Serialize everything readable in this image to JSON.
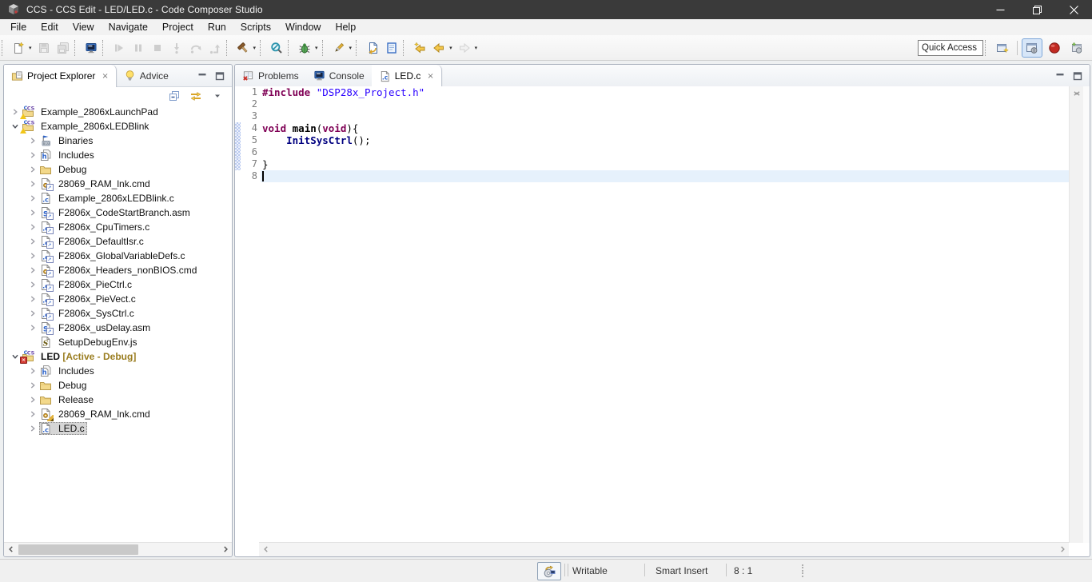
{
  "window": {
    "title": "CCS - CCS Edit - LED/LED.c - Code Composer Studio",
    "controls": [
      {
        "name": "minimize",
        "glyph": "minimize"
      },
      {
        "name": "restore",
        "glyph": "restore"
      },
      {
        "name": "close",
        "glyph": "close"
      }
    ]
  },
  "menu": {
    "items": [
      "File",
      "Edit",
      "View",
      "Navigate",
      "Project",
      "Run",
      "Scripts",
      "Window",
      "Help"
    ]
  },
  "toolbar": {
    "quick_access_placeholder": "Quick Access",
    "groups": [
      {
        "items": [
          {
            "name": "new",
            "icon": "new-file",
            "dropdown": true
          },
          {
            "name": "save",
            "icon": "save",
            "disabled": true
          },
          {
            "name": "save-all",
            "icon": "save-all",
            "disabled": true
          }
        ]
      },
      {
        "items": [
          {
            "name": "debug-target",
            "icon": "monitor"
          }
        ]
      },
      {
        "items": [
          {
            "name": "resume",
            "icon": "resume",
            "disabled": true
          },
          {
            "name": "suspend",
            "icon": "pause",
            "disabled": true
          },
          {
            "name": "terminate",
            "icon": "stop",
            "disabled": true
          },
          {
            "name": "step-into",
            "icon": "step-into",
            "disabled": true
          },
          {
            "name": "step-over",
            "icon": "step-over",
            "disabled": true
          },
          {
            "name": "step-return",
            "icon": "step-return",
            "disabled": true
          }
        ]
      },
      {
        "items": [
          {
            "name": "build",
            "icon": "hammer",
            "dropdown": true
          }
        ]
      },
      {
        "items": [
          {
            "name": "scan",
            "icon": "magnifier"
          }
        ]
      },
      {
        "items": [
          {
            "name": "debug",
            "icon": "bug",
            "dropdown": true
          }
        ]
      },
      {
        "items": [
          {
            "name": "flash",
            "icon": "flash",
            "dropdown": true
          }
        ]
      },
      {
        "items": [
          {
            "name": "last-edit-location",
            "icon": "edit-location"
          },
          {
            "name": "pin-editor",
            "icon": "pin-page"
          }
        ]
      },
      {
        "items": [
          {
            "name": "back-to-last-edit",
            "icon": "arrow-left-star"
          },
          {
            "name": "back",
            "icon": "arrow-left",
            "dropdown": true
          },
          {
            "name": "forward",
            "icon": "arrow-right",
            "disabled": true,
            "dropdown": true
          }
        ]
      }
    ],
    "perspectives": [
      {
        "name": "open-perspective",
        "icon": "persp-new",
        "active": false
      },
      {
        "name": "ccs-edit-perspective",
        "icon": "persp-edit",
        "active": true
      },
      {
        "name": "simple-perspective",
        "icon": "red-sphere",
        "active": false
      },
      {
        "name": "ccs-debug-perspective",
        "icon": "persp-debug",
        "active": false
      }
    ]
  },
  "sidebar": {
    "tabs": [
      {
        "label": "Project Explorer",
        "icon": "pe-folder",
        "active": true,
        "closable": true
      },
      {
        "label": "Advice",
        "icon": "bulb",
        "active": false,
        "closable": false
      }
    ],
    "toolbar": [
      {
        "name": "collapse-all",
        "icon": "collapse-all"
      },
      {
        "name": "link-with-editor",
        "icon": "link-editor"
      },
      {
        "name": "view-menu",
        "icon": "caret-down"
      }
    ],
    "tree": [
      {
        "label": "Example_2806xLaunchPad",
        "icon": "project-warning",
        "depth": 0,
        "arrow": "collapsed"
      },
      {
        "label": "Example_2806xLEDBlink",
        "icon": "project-warning",
        "depth": 0,
        "arrow": "expanded"
      },
      {
        "label": "Binaries",
        "icon": "binaries",
        "depth": 1,
        "arrow": "collapsed"
      },
      {
        "label": "Includes",
        "icon": "includes",
        "depth": 1,
        "arrow": "collapsed"
      },
      {
        "label": "Debug",
        "icon": "folder",
        "depth": 1,
        "arrow": "collapsed"
      },
      {
        "label": "28069_RAM_lnk.cmd",
        "icon": "file-cmd-linked",
        "depth": 1,
        "arrow": "collapsed"
      },
      {
        "label": "Example_2806xLEDBlink.c",
        "icon": "file-c",
        "depth": 1,
        "arrow": "collapsed"
      },
      {
        "label": "F2806x_CodeStartBranch.asm",
        "icon": "file-asm-linked",
        "depth": 1,
        "arrow": "collapsed"
      },
      {
        "label": "F2806x_CpuTimers.c",
        "icon": "file-c-linked",
        "depth": 1,
        "arrow": "collapsed"
      },
      {
        "label": "F2806x_DefaultIsr.c",
        "icon": "file-c-linked",
        "depth": 1,
        "arrow": "collapsed"
      },
      {
        "label": "F2806x_GlobalVariableDefs.c",
        "icon": "file-c-linked",
        "depth": 1,
        "arrow": "collapsed"
      },
      {
        "label": "F2806x_Headers_nonBIOS.cmd",
        "icon": "file-cmd-linked",
        "depth": 1,
        "arrow": "collapsed"
      },
      {
        "label": "F2806x_PieCtrl.c",
        "icon": "file-c-linked",
        "depth": 1,
        "arrow": "collapsed"
      },
      {
        "label": "F2806x_PieVect.c",
        "icon": "file-c-linked",
        "depth": 1,
        "arrow": "collapsed"
      },
      {
        "label": "F2806x_SysCtrl.c",
        "icon": "file-c-linked",
        "depth": 1,
        "arrow": "collapsed"
      },
      {
        "label": "F2806x_usDelay.asm",
        "icon": "file-asm-linked",
        "depth": 1,
        "arrow": "collapsed"
      },
      {
        "label": "SetupDebugEnv.js",
        "icon": "file-js",
        "depth": 1,
        "arrow": "none"
      },
      {
        "label": "LED",
        "suffix": " [Active - Debug]",
        "icon": "project-error",
        "depth": 0,
        "arrow": "expanded",
        "bold": true
      },
      {
        "label": "Includes",
        "icon": "includes",
        "depth": 1,
        "arrow": "collapsed"
      },
      {
        "label": "Debug",
        "icon": "folder",
        "depth": 1,
        "arrow": "collapsed"
      },
      {
        "label": "Release",
        "icon": "folder",
        "depth": 1,
        "arrow": "collapsed"
      },
      {
        "label": "28069_RAM_lnk.cmd",
        "icon": "file-cmd-edit",
        "depth": 1,
        "arrow": "collapsed"
      },
      {
        "label": "LED.c",
        "icon": "file-c",
        "depth": 1,
        "arrow": "collapsed",
        "selected": true
      }
    ]
  },
  "editor": {
    "tabs": [
      {
        "label": "Problems",
        "icon": "problems",
        "active": false,
        "closable": false
      },
      {
        "label": "Console",
        "icon": "monitor",
        "active": false,
        "closable": false
      },
      {
        "label": "LED.c",
        "icon": "file-c",
        "active": true,
        "closable": true
      }
    ],
    "caret_line": 8,
    "lines": [
      {
        "n": 1,
        "segs": [
          {
            "t": "#include ",
            "c": "pp"
          },
          {
            "t": "\"DSP28x_Project.h\"",
            "c": "str"
          }
        ]
      },
      {
        "n": 2,
        "segs": []
      },
      {
        "n": 3,
        "segs": []
      },
      {
        "n": 4,
        "diff": true,
        "segs": [
          {
            "t": "void",
            "c": "kw"
          },
          {
            "t": " ",
            "c": "pl"
          },
          {
            "t": "main",
            "c": "fn"
          },
          {
            "t": "(",
            "c": "pl"
          },
          {
            "t": "void",
            "c": "kw"
          },
          {
            "t": "){",
            "c": "pl"
          }
        ]
      },
      {
        "n": 5,
        "diff": true,
        "segs": [
          {
            "t": "    ",
            "c": "pl"
          },
          {
            "t": "InitSysCtrl",
            "c": "call"
          },
          {
            "t": "();",
            "c": "pl"
          }
        ]
      },
      {
        "n": 6,
        "diff": true,
        "segs": []
      },
      {
        "n": 7,
        "diff": true,
        "segs": [
          {
            "t": "}",
            "c": "pl"
          }
        ]
      },
      {
        "n": 8,
        "current": true,
        "segs": []
      }
    ]
  },
  "statusbar": {
    "launcher_icon": "resource-explorer",
    "items": [
      "Writable",
      "Smart Insert",
      "8 : 1"
    ]
  },
  "colors": {
    "titlebar": "#3a3a3a",
    "selection_inactive": "#d6d6d6",
    "current_line_highlight": "#e6f1fc",
    "syntax_directive": "#7f0055",
    "syntax_string": "#2a00ff",
    "syntax_function_call": "#000080",
    "active_project_suffix": "#9a7d20"
  }
}
